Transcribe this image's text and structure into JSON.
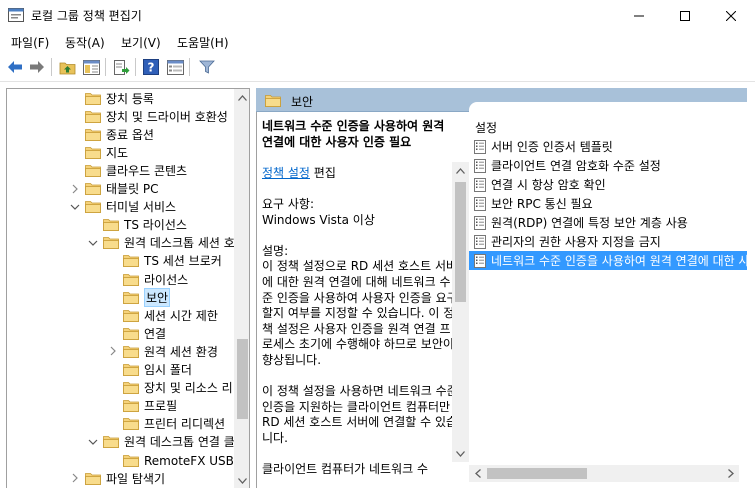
{
  "window": {
    "title": "로컬 그룹 정책 편집기"
  },
  "menu": {
    "items": [
      "파일(F)",
      "동작(A)",
      "보기(V)",
      "도움말(H)"
    ]
  },
  "toolbar": {
    "buttons": [
      "back-arrow-icon",
      "forward-arrow-icon",
      "up-folder-icon",
      "show-hide-tree-icon",
      "export-list-icon",
      "help-icon",
      "properties-icon",
      "filter-icon"
    ]
  },
  "tree": {
    "items": [
      {
        "label": "장치 등록",
        "expander": "none",
        "selected": false
      },
      {
        "label": "장치 및 드라이버 호환성",
        "expander": "none",
        "selected": false
      },
      {
        "label": "종료 옵션",
        "expander": "none",
        "selected": false
      },
      {
        "label": "지도",
        "expander": "none",
        "selected": false
      },
      {
        "label": "클라우드 콘텐츠",
        "expander": "none",
        "selected": false
      },
      {
        "label": "태블릿 PC",
        "expander": "collapsed",
        "selected": false
      },
      {
        "label": "터미널 서비스",
        "expander": "expanded",
        "selected": false
      },
      {
        "label": "TS 라이선스",
        "expander": "none",
        "selected": false
      },
      {
        "label": "원격 데스크톱 세션 호스트",
        "expander": "expanded",
        "selected": false
      },
      {
        "label": "TS 세션 브로커",
        "expander": "none",
        "selected": false
      },
      {
        "label": "라이선스",
        "expander": "none",
        "selected": false
      },
      {
        "label": "보안",
        "expander": "none",
        "selected": true
      },
      {
        "label": "세션 시간 제한",
        "expander": "none",
        "selected": false
      },
      {
        "label": "연결",
        "expander": "none",
        "selected": false
      },
      {
        "label": "원격 세션 환경",
        "expander": "collapsed",
        "selected": false
      },
      {
        "label": "임시 폴더",
        "expander": "none",
        "selected": false
      },
      {
        "label": "장치 및 리소스 리디렉션",
        "expander": "none",
        "selected": false
      },
      {
        "label": "프로필",
        "expander": "none",
        "selected": false
      },
      {
        "label": "프린터 리디렉션",
        "expander": "none",
        "selected": false
      },
      {
        "label": "원격 데스크톱 연결 클라이언트",
        "expander": "expanded",
        "selected": false
      },
      {
        "label": "RemoteFX USB 디바이스 리디렉션",
        "expander": "none",
        "selected": false
      },
      {
        "label": "파일 탐색기",
        "expander": "collapsed",
        "selected": false
      }
    ]
  },
  "right": {
    "header_title": "보안",
    "description": {
      "title": "네트워크 수준 인증을 사용하여 원격 연결에 대한 사용자 인증 필요",
      "edit_link": "정책 설정",
      "edit_suffix": " 편집",
      "req_label": "요구 사항:",
      "req_value": "Windows Vista 이상",
      "desc_label": "설명:",
      "desc_p1": "이 정책 설정으로 RD 세션 호스트 서버에 대한 원격 연결에 대해 네트워크 수준 인증을 사용하여 사용자 인증을 요구할지 여부를 지정할 수 있습니다. 이 정책 설정은 사용자 인증을 원격 연결 프로세스 초기에 수행해야 하므로 보안이 향상됩니다.",
      "desc_p2": "이 정책 설정을 사용하면 네트워크 수준 인증을 지원하는 클라이언트 컴퓨터만 RD 세션 호스트 서버에 연결할 수 있습니다.",
      "desc_p3": "클라이언트 컴퓨터가 네트워크 수"
    },
    "column_header": "설정",
    "settings": [
      {
        "label": "서버 인증 인증서 템플릿",
        "selected": false
      },
      {
        "label": "클라이언트 연결 암호화 수준 설정",
        "selected": false
      },
      {
        "label": "연결 시 항상 암호 확인",
        "selected": false
      },
      {
        "label": "보안 RPC 통신 필요",
        "selected": false
      },
      {
        "label": "원격(RDP) 연결에 특정 보안 계층 사용",
        "selected": false
      },
      {
        "label": "관리자의 권한 사용자 지정을 금지",
        "selected": false
      },
      {
        "label": "네트워크 수준 인증을 사용하여 원격 연결에 대한 사용자 인증 필요",
        "selected": true
      }
    ]
  },
  "colors": {
    "header_bg": "#a8c1d9",
    "selection_bg": "#3399ff",
    "tree_selection_bg": "#cce8ff",
    "link": "#0066cc"
  }
}
